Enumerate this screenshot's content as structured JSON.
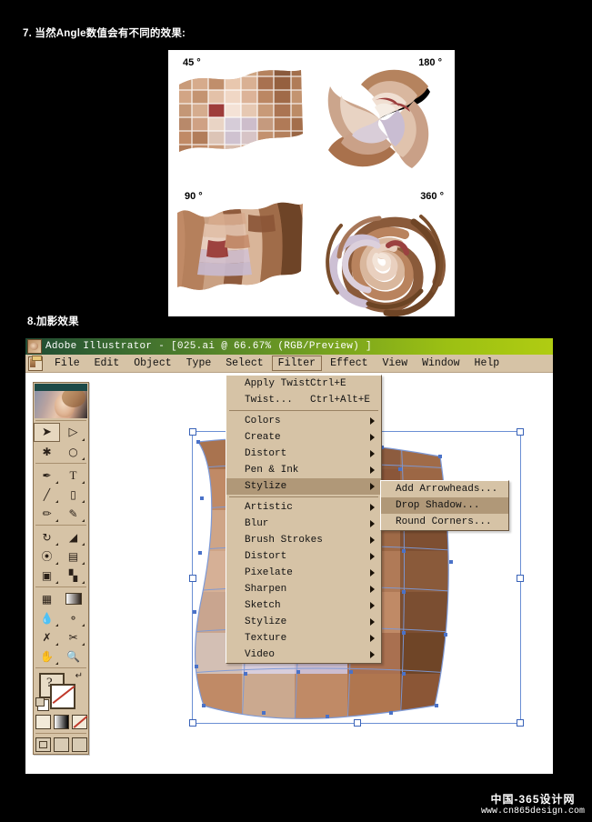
{
  "steps": {
    "step7": "7. 当然Angle数值会有不同的效果:",
    "step8": "8.加影效果"
  },
  "figures": [
    {
      "label": "45 °",
      "angle": 45
    },
    {
      "label": "180 °",
      "angle": 180
    },
    {
      "label": "90 °",
      "angle": 90
    },
    {
      "label": "360 °",
      "angle": 360
    }
  ],
  "app": {
    "title": "Adobe Illustrator - [025.ai @ 66.67% (RGB/Preview) ]",
    "title_icon": "illustrator-app-icon",
    "menubar": {
      "doc_icon": "document-control-icon",
      "items": [
        {
          "label": "File",
          "active": false
        },
        {
          "label": "Edit",
          "active": false
        },
        {
          "label": "Object",
          "active": false
        },
        {
          "label": "Type",
          "active": false
        },
        {
          "label": "Select",
          "active": false
        },
        {
          "label": "Filter",
          "active": true
        },
        {
          "label": "Effect",
          "active": false
        },
        {
          "label": "View",
          "active": false
        },
        {
          "label": "Window",
          "active": false
        },
        {
          "label": "Help",
          "active": false
        }
      ]
    }
  },
  "filter_menu": {
    "groups": [
      [
        {
          "label": "Apply Twist",
          "shortcut": "Ctrl+E",
          "submenu": false,
          "highlighted": false
        },
        {
          "label": "Twist...",
          "shortcut": "Ctrl+Alt+E",
          "submenu": false,
          "highlighted": false
        }
      ],
      [
        {
          "label": "Colors",
          "shortcut": "",
          "submenu": true,
          "highlighted": false
        },
        {
          "label": "Create",
          "shortcut": "",
          "submenu": true,
          "highlighted": false
        },
        {
          "label": "Distort",
          "shortcut": "",
          "submenu": true,
          "highlighted": false
        },
        {
          "label": "Pen & Ink",
          "shortcut": "",
          "submenu": true,
          "highlighted": false
        },
        {
          "label": "Stylize",
          "shortcut": "",
          "submenu": true,
          "highlighted": true
        }
      ],
      [
        {
          "label": "Artistic",
          "shortcut": "",
          "submenu": true,
          "highlighted": false
        },
        {
          "label": "Blur",
          "shortcut": "",
          "submenu": true,
          "highlighted": false
        },
        {
          "label": "Brush Strokes",
          "shortcut": "",
          "submenu": true,
          "highlighted": false
        },
        {
          "label": "Distort",
          "shortcut": "",
          "submenu": true,
          "highlighted": false
        },
        {
          "label": "Pixelate",
          "shortcut": "",
          "submenu": true,
          "highlighted": false
        },
        {
          "label": "Sharpen",
          "shortcut": "",
          "submenu": true,
          "highlighted": false
        },
        {
          "label": "Sketch",
          "shortcut": "",
          "submenu": true,
          "highlighted": false
        },
        {
          "label": "Stylize",
          "shortcut": "",
          "submenu": true,
          "highlighted": false
        },
        {
          "label": "Texture",
          "shortcut": "",
          "submenu": true,
          "highlighted": false
        },
        {
          "label": "Video",
          "shortcut": "",
          "submenu": true,
          "highlighted": false
        }
      ]
    ]
  },
  "stylize_submenu": {
    "items": [
      {
        "label": "Add Arrowheads...",
        "highlighted": false
      },
      {
        "label": "Drop Shadow...",
        "highlighted": true
      },
      {
        "label": "Round Corners...",
        "highlighted": false
      }
    ]
  },
  "toolbox": {
    "header_icon": "venus-logo-image",
    "tools": [
      [
        {
          "icon": "selection-arrow-tool",
          "selected": true,
          "menu": false
        },
        {
          "icon": "direct-selection-tool",
          "selected": false,
          "menu": true
        }
      ],
      [
        {
          "icon": "magic-wand-tool",
          "selected": false,
          "menu": false
        },
        {
          "icon": "lasso-tool",
          "selected": false,
          "menu": true
        }
      ],
      [
        {
          "icon": "pen-tool",
          "selected": false,
          "menu": true
        },
        {
          "icon": "type-tool",
          "selected": false,
          "menu": true
        }
      ],
      [
        {
          "icon": "line-segment-tool",
          "selected": false,
          "menu": true
        },
        {
          "icon": "rectangle-tool",
          "selected": false,
          "menu": true
        }
      ],
      [
        {
          "icon": "paintbrush-tool",
          "selected": false,
          "menu": true
        },
        {
          "icon": "pencil-tool",
          "selected": false,
          "menu": true
        }
      ],
      [
        {
          "icon": "rotate-tool",
          "selected": false,
          "menu": true
        },
        {
          "icon": "scale-tool",
          "selected": false,
          "menu": true
        }
      ],
      [
        {
          "icon": "warp-tool",
          "selected": false,
          "menu": true
        },
        {
          "icon": "free-transform-tool",
          "selected": false,
          "menu": true
        }
      ],
      [
        {
          "icon": "symbol-sprayer-tool",
          "selected": false,
          "menu": true
        },
        {
          "icon": "column-graph-tool",
          "selected": false,
          "menu": true
        }
      ],
      [
        {
          "icon": "mesh-tool",
          "selected": false,
          "menu": false
        },
        {
          "icon": "gradient-tool",
          "selected": false,
          "menu": false
        }
      ],
      [
        {
          "icon": "eyedropper-tool",
          "selected": false,
          "menu": true
        },
        {
          "icon": "blend-tool",
          "selected": false,
          "menu": true
        }
      ],
      [
        {
          "icon": "slice-tool",
          "selected": false,
          "menu": true
        },
        {
          "icon": "scissors-tool",
          "selected": false,
          "menu": true
        }
      ],
      [
        {
          "icon": "hand-tool",
          "selected": false,
          "menu": true
        },
        {
          "icon": "zoom-tool",
          "selected": false,
          "menu": false
        }
      ]
    ],
    "color_controls": {
      "fill_icon": "fill-swatch-unknown",
      "stroke_icon": "stroke-swatch-none",
      "swap_icon": "swap-fill-stroke-icon",
      "default_icon": "default-fill-stroke-icon"
    },
    "paint_modes": [
      "color-swatch",
      "gradient-swatch",
      "none-swatch"
    ],
    "screen_modes": [
      "standard-screen-mode",
      "full-screen-menubar-mode",
      "full-screen-mode"
    ]
  },
  "colors": {
    "titlebar_start": "#1f4a33",
    "titlebar_end": "#b0cc12",
    "chrome": "#d6c3a6",
    "menu_highlight": "#b09878",
    "selection_blue": "#6b8fd4",
    "canvas": "#ffffff",
    "page_background": "#000000"
  },
  "watermark": {
    "line1": "中国-365设计网",
    "line2": "www.cn865design.com"
  }
}
